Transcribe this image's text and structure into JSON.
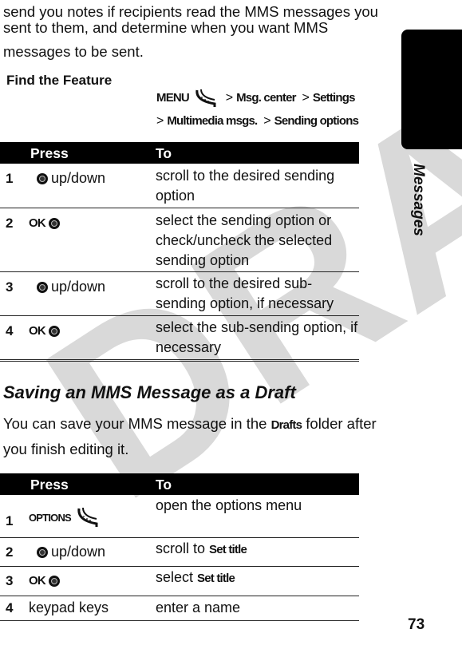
{
  "intro": {
    "line1": "send you notes if recipients read the MMS messages you",
    "line2": "sent to them, and determine when you want MMS",
    "line3": "messages to be sent."
  },
  "find_feature": {
    "label": "Find the Feature",
    "path": [
      "MENU",
      "Msg. center",
      "Settings",
      "Multimedia msgs.",
      "Sending options"
    ],
    "separator": ">",
    "menu_key_icon": "soft-key-icon"
  },
  "table1": {
    "headers": {
      "press": "Press",
      "to": "To"
    },
    "rows": [
      {
        "num": "1",
        "key_label": "",
        "icon": "nav-key-icon",
        "press_text": "up/down",
        "to": "scroll to the desired sending option"
      },
      {
        "num": "2",
        "key_label": "OK",
        "icon": "nav-key-icon",
        "press_text": "",
        "to": "select the sending option or check/uncheck the selected sending option"
      },
      {
        "num": "3",
        "key_label": "",
        "icon": "nav-key-icon",
        "press_text": "up/down",
        "to": "scroll to the desired sub-sending option, if necessary"
      },
      {
        "num": "4",
        "key_label": "OK",
        "icon": "nav-key-icon",
        "press_text": "",
        "to": "select the sub-sending option, if necessary"
      }
    ]
  },
  "section2": {
    "heading": "Saving an MMS Message as a Draft",
    "para_pre": "You can save your MMS message in the ",
    "para_bold": "Drafts",
    "para_post": " folder after",
    "para_line2": "you finish editing it."
  },
  "table2": {
    "headers": {
      "press": "Press",
      "to": "To"
    },
    "rows": [
      {
        "num": "1",
        "key_label": "OPTIONS",
        "icon": "soft-key-icon",
        "press_text": "",
        "to_pre": "open the options menu",
        "to_bold": ""
      },
      {
        "num": "2",
        "key_label": "",
        "icon": "nav-key-icon",
        "press_text": "up/down",
        "to_pre": "scroll to ",
        "to_bold": "Set title"
      },
      {
        "num": "3",
        "key_label": "OK",
        "icon": "nav-key-icon",
        "press_text": "",
        "to_pre": "select ",
        "to_bold": "Set title"
      },
      {
        "num": "4",
        "key_label": "",
        "icon": "",
        "press_text": "keypad keys",
        "to_pre": "enter a name",
        "to_bold": ""
      }
    ]
  },
  "side": {
    "label": "Messages"
  },
  "page_number": "73",
  "watermark": "DRAFT"
}
